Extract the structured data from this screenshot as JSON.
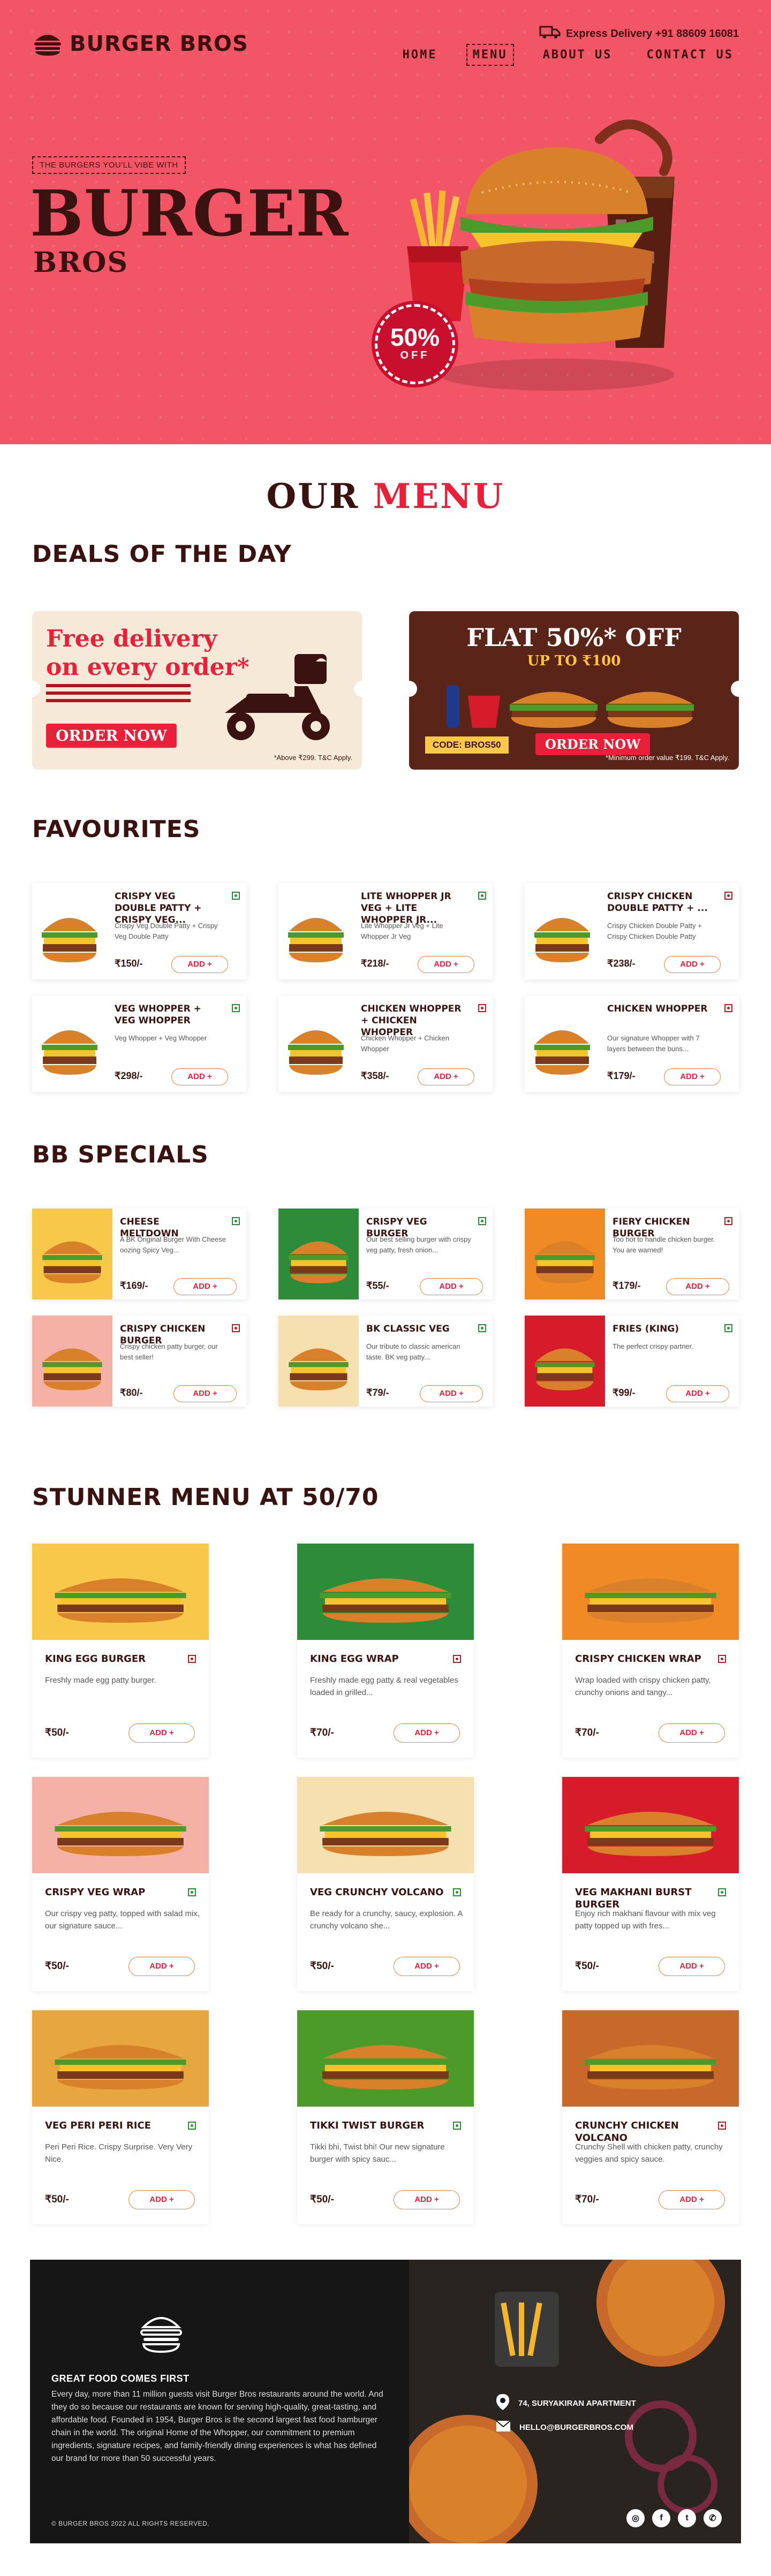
{
  "brand": {
    "name": "BURGER BROS"
  },
  "nav": {
    "delivery": "Express Delivery +91 88609 16081",
    "items": [
      {
        "label": "HOME"
      },
      {
        "label": "MENU"
      },
      {
        "label": "ABOUT US"
      },
      {
        "label": "CONTACT US"
      }
    ]
  },
  "hero": {
    "tagline": "THE BURGERS YOU'LL VIBE WITH",
    "title": "BURGER",
    "subtitle": "BROS",
    "discount_pct": "50%",
    "discount_label": "OFF"
  },
  "our_menu": {
    "part1": "OUR",
    "part2": "MENU"
  },
  "deals": {
    "title": "DEALS OF THE DAY",
    "left": {
      "headline": "Free delivery on every order*",
      "cta": "ORDER NOW",
      "note": "*Above ₹299. T&C Apply."
    },
    "right": {
      "headline": "FLAT 50%* OFF",
      "sub": "UP TO ₹100",
      "code": "CODE: BROS50",
      "cta": "ORDER NOW",
      "note": "*Minimum order value ₹199. T&C Apply."
    }
  },
  "favourites": {
    "title": "FAVOURITES",
    "items": [
      {
        "name": "CRISPY VEG DOUBLE PATTY + CRISPY VEG...",
        "desc": "Crispy Veg Double Patty + Crispy Veg Double Patty",
        "price": "₹150/-",
        "add": "ADD +",
        "veg": true
      },
      {
        "name": "LITE WHOPPER JR VEG + LITE WHOPPER JR...",
        "desc": "Lite Whopper Jr Veg + Lite Whopper Jr Veg",
        "price": "₹218/-",
        "add": "ADD +",
        "veg": true
      },
      {
        "name": "CRISPY CHICKEN DOUBLE PATTY + ...",
        "desc": "Crispy Chicken Double Patty + Crispy Chicken Double Patty",
        "price": "₹238/-",
        "add": "ADD +",
        "veg": false
      },
      {
        "name": "VEG WHOPPER + VEG WHOPPER",
        "desc": "Veg Whopper + Veg Whopper",
        "price": "₹298/-",
        "add": "ADD +",
        "veg": true
      },
      {
        "name": "CHICKEN WHOPPER + CHICKEN WHOPPER",
        "desc": "Chicken Whopper + Chicken Whopper",
        "price": "₹358/-",
        "add": "ADD +",
        "veg": false
      },
      {
        "name": "CHICKEN WHOPPER",
        "desc": "Our signature Whopper with 7 layers between the buns...",
        "price": "₹179/-",
        "add": "ADD +",
        "veg": false
      }
    ]
  },
  "specials": {
    "title": "BB SPECIALS",
    "items": [
      {
        "name": "CHEESE MELTDOWN",
        "desc": "A BK Original Burger With Cheese oozing Spicy Veg...",
        "price": "₹169/-",
        "add": "ADD +",
        "veg": true
      },
      {
        "name": "CRISPY VEG BURGER",
        "desc": "Our best selling burger with crispy veg patty, fresh onion...",
        "price": "₹55/-",
        "add": "ADD +",
        "veg": true
      },
      {
        "name": "FIERY CHICKEN BURGER",
        "desc": "Too hot to handle chicken burger. You are warned!",
        "price": "₹179/-",
        "add": "ADD +",
        "veg": false
      },
      {
        "name": "CRISPY CHICKEN BURGER",
        "desc": "Crispy chicken patty burger, our best seller!",
        "price": "₹80/-",
        "add": "ADD +",
        "veg": false
      },
      {
        "name": "BK CLASSIC VEG",
        "desc": "Our tribute to classic american taste. BK veg patty...",
        "price": "₹79/-",
        "add": "ADD +",
        "veg": true
      },
      {
        "name": "FRIES (KING)",
        "desc": "The perfect crispy partner.",
        "price": "₹99/-",
        "add": "ADD +",
        "veg": true
      }
    ]
  },
  "stunner": {
    "title": "STUNNER MENU AT 50/70",
    "items": [
      {
        "name": "KING EGG BURGER",
        "desc": "Freshly made egg patty burger.",
        "price": "₹50/-",
        "add": "ADD +",
        "veg": false
      },
      {
        "name": "KING EGG WRAP",
        "desc": "Freshly made egg patty & real vegetables loaded in grilled...",
        "price": "₹70/-",
        "add": "ADD +",
        "veg": false
      },
      {
        "name": "CRISPY CHICKEN WRAP",
        "desc": "Wrap loaded with crispy chicken patty, crunchy onions and tangy...",
        "price": "₹70/-",
        "add": "ADD +",
        "veg": false
      },
      {
        "name": "CRISPY VEG WRAP",
        "desc": "Our crispy veg patty, topped with salad mix, our signature sauce...",
        "price": "₹50/-",
        "add": "ADD +",
        "veg": true
      },
      {
        "name": "VEG CRUNCHY VOLCANO",
        "desc": "Be ready for a crunchy, saucy, explosion. A crunchy volcano she...",
        "price": "₹50/-",
        "add": "ADD +",
        "veg": true
      },
      {
        "name": "VEG MAKHANI BURST BURGER",
        "desc": "Enjoy rich makhani flavour with mix veg patty topped up with fres...",
        "price": "₹50/-",
        "add": "ADD +",
        "veg": true
      },
      {
        "name": "VEG PERI PERI RICE",
        "desc": "Peri Peri Rice. Crispy Surprise. Very Very Nice.",
        "price": "₹50/-",
        "add": "ADD +",
        "veg": true
      },
      {
        "name": "TIKKI TWIST BURGER",
        "desc": "Tikki bhi, Twist bhi! Our new signature burger with spicy sauc...",
        "price": "₹50/-",
        "add": "ADD +",
        "veg": true
      },
      {
        "name": "CRUNCHY CHICKEN VOLCANO",
        "desc": "Crunchy Shell with chicken patty, crunchy veggies and spicy sauce.",
        "price": "₹70/-",
        "add": "ADD +",
        "veg": false
      }
    ]
  },
  "footer": {
    "heading": "GREAT FOOD COMES FIRST",
    "body": "Every day, more than 11 million guests visit Burger Bros restaurants around the world. And they do so because our restaurants are known for serving high-quality, great-tasting, and affordable food. Founded in 1954, Burger Bros is the second largest fast food hamburger chain in the world. The original Home of the Whopper, our commitment to premium ingredients, signature recipes, and family-friendly dining experiences is what has defined our brand for more than 50 successful years.",
    "address": "74, SURYAKIRAN APARTMENT",
    "email": "HELLO@BURGERBROS.COM",
    "copyright": "© BURGER BROS 2022 ALL RIGHTS RESERVED.",
    "socials": [
      {
        "glyph": "◎",
        "icon": "instagram-icon"
      },
      {
        "glyph": "f",
        "icon": "facebook-icon"
      },
      {
        "glyph": "t",
        "icon": "twitter-icon"
      },
      {
        "glyph": "✆",
        "icon": "whatsapp-icon"
      }
    ]
  }
}
